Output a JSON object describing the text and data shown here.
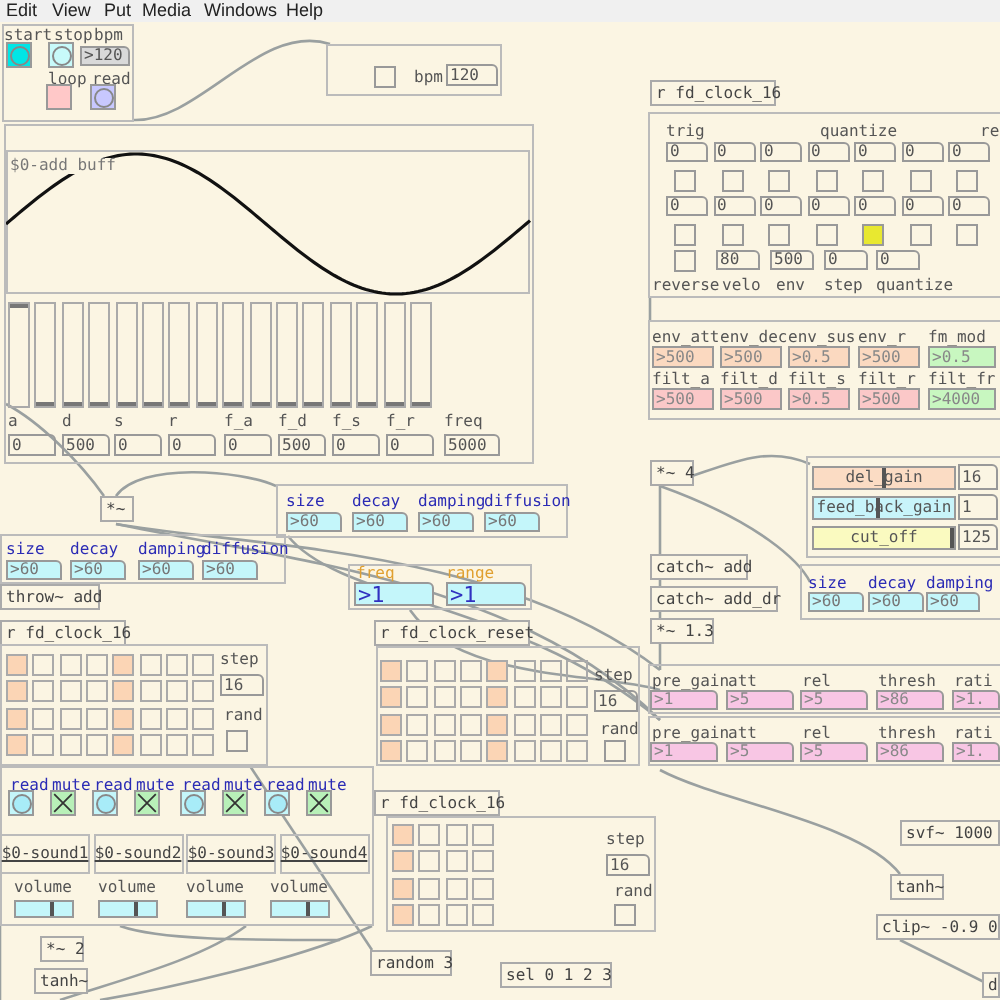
{
  "menu": [
    "Edit",
    "View",
    "Put",
    "Media",
    "Windows",
    "Help"
  ],
  "transport": {
    "labels": [
      "start",
      "stop",
      "bpm"
    ],
    "bpm": ">120",
    "loop_label": "loop",
    "read_label": "read"
  },
  "bpm_box": {
    "on": false,
    "label": "bpm",
    "value": "120"
  },
  "array": {
    "name": "$0-add buff"
  },
  "sliders": [
    {
      "level": 1
    },
    {
      "level": 0
    },
    {
      "level": 0
    },
    {
      "level": 0
    },
    {
      "level": 0
    },
    {
      "level": 0
    },
    {
      "level": 0
    },
    {
      "level": 0
    },
    {
      "level": 0
    },
    {
      "level": 0
    },
    {
      "level": 0
    },
    {
      "level": 0
    },
    {
      "level": 0
    },
    {
      "level": 0
    },
    {
      "level": 0
    },
    {
      "level": 0
    }
  ],
  "envelope": [
    {
      "label": "a",
      "value": "0"
    },
    {
      "label": "d",
      "value": "500"
    },
    {
      "label": "s",
      "value": "0"
    },
    {
      "label": "r",
      "value": "0"
    },
    {
      "label": "f_a",
      "value": "0"
    },
    {
      "label": "f_d",
      "value": "500"
    },
    {
      "label": "f_s",
      "value": "0"
    },
    {
      "label": "f_r",
      "value": "0"
    },
    {
      "label": "freq",
      "value": "5000"
    }
  ],
  "objects": [
    "*~",
    "throw~ add",
    "r fd_clock_16",
    "r fd_clock_reset",
    "r fd_clock_16",
    "*~ 2",
    "tanh~",
    "random 3",
    "sel 0 1 2 3",
    "r fd_clock_16",
    "*~ 4",
    "catch~ add",
    "catch~ add_dr",
    "*~ 1.3",
    "svf~ 1000",
    "tanh~",
    "clip~ -0.9 0",
    "d"
  ],
  "reverbs": [
    {
      "params": [
        {
          "label": "size",
          "value": ">60"
        },
        {
          "label": "decay",
          "value": ">60"
        },
        {
          "label": "damping",
          "value": ">60"
        },
        {
          "label": "diffusion",
          "value": ">60"
        }
      ]
    },
    {
      "params": [
        {
          "label": "size",
          "value": ">60"
        },
        {
          "label": "decay",
          "value": ">60"
        },
        {
          "label": "damping",
          "value": ">60"
        },
        {
          "label": "diffusion",
          "value": ">60"
        }
      ]
    },
    {
      "params": [
        {
          "label": "size",
          "value": ">60"
        },
        {
          "label": "decay",
          "value": ">60"
        },
        {
          "label": "damping",
          "value": ">60"
        }
      ]
    }
  ],
  "freq_range": [
    {
      "label": "freq",
      "value": ">1"
    },
    {
      "label": "range",
      "value": ">1"
    }
  ],
  "sequencers": [
    {
      "grid": [
        [
          true,
          false,
          false,
          false,
          true,
          false,
          false,
          false
        ],
        [
          true,
          false,
          false,
          false,
          true,
          false,
          false,
          false
        ],
        [
          true,
          false,
          false,
          false,
          true,
          false,
          false,
          false
        ],
        [
          true,
          false,
          false,
          false,
          true,
          false,
          false,
          false
        ]
      ],
      "step_label": "step",
      "step": "16",
      "rand_label": "rand",
      "rand_on": false
    },
    {
      "grid": [
        [
          true,
          false,
          false,
          false,
          true,
          false,
          false,
          false
        ],
        [
          true,
          false,
          false,
          false,
          true,
          false,
          false,
          false
        ],
        [
          true,
          false,
          false,
          false,
          true,
          false,
          false,
          false
        ],
        [
          true,
          false,
          false,
          false,
          true,
          false,
          false,
          false
        ]
      ],
      "step_label": "step",
      "step": "16",
      "rand_label": "rand",
      "rand_on": false
    },
    {
      "grid": [
        [
          true,
          false,
          false,
          false
        ],
        [
          true,
          false,
          false,
          false
        ],
        [
          true,
          false,
          false,
          false
        ],
        [
          true,
          false,
          false,
          false
        ]
      ],
      "step_label": "step",
      "step": "16",
      "rand_label": "rand",
      "rand_on": false
    }
  ],
  "samplers": [
    {
      "read": "read",
      "mute": "mute",
      "muted": true,
      "array": "$0-sound1",
      "volume_label": "volume",
      "level": 0.65
    },
    {
      "read": "read",
      "mute": "mute",
      "muted": true,
      "array": "$0-sound2",
      "volume_label": "volume",
      "level": 0.65
    },
    {
      "read": "read",
      "mute": "mute",
      "muted": true,
      "array": "$0-sound3",
      "volume_label": "volume",
      "level": 0.65
    },
    {
      "read": "read",
      "mute": "mute",
      "muted": true,
      "array": "$0-sound4",
      "volume_label": "volume",
      "level": 0.65
    }
  ],
  "trig_panel": {
    "labels": [
      "trig",
      "quantize",
      "re"
    ],
    "row1": [
      "0",
      "0",
      "0",
      "0",
      "0",
      "0",
      "0"
    ],
    "toggles1": [
      false,
      false,
      false,
      false,
      false,
      false,
      false
    ],
    "row2": [
      "0",
      "0",
      "0",
      "0",
      "0",
      "0",
      "0"
    ],
    "toggles2": [
      false,
      false,
      false,
      false,
      true,
      false,
      false
    ],
    "reverse_on": false,
    "values": [
      "80",
      "500",
      "0",
      "0"
    ],
    "bottom_labels": [
      "reverse",
      "velo",
      "env",
      "step",
      "quantize"
    ]
  },
  "synth": [
    [
      {
        "label": "env_att",
        "value": ">500",
        "color": "#fbd9c0"
      },
      {
        "label": "env_dec",
        "value": ">500",
        "color": "#fbd9c0"
      },
      {
        "label": "env_sus",
        "value": ">0.5",
        "color": "#fbd9c0"
      },
      {
        "label": "env_r",
        "value": ">500",
        "color": "#fbd9c0"
      },
      {
        "label": "fm_mod",
        "value": ">0.5",
        "color": "#c8f7c0"
      }
    ],
    [
      {
        "label": "filt_a",
        "value": ">500",
        "color": "#fbc8c8"
      },
      {
        "label": "filt_d",
        "value": ">500",
        "color": "#fbc8c8"
      },
      {
        "label": "filt_s",
        "value": ">0.5",
        "color": "#fbc8c8"
      },
      {
        "label": "filt_r",
        "value": ">500",
        "color": "#fbc8c8"
      },
      {
        "label": "filt_fr",
        "value": ">4000",
        "color": "#c8f7c0"
      }
    ]
  ],
  "mixer": [
    {
      "label": "del_gain",
      "value": "16",
      "color": "#fbdcc4",
      "level": 0.5
    },
    {
      "label": "feed_back_gain",
      "value": "1",
      "color": "#c8f4fa",
      "level": 0.45
    },
    {
      "label": "cut_off",
      "value": "125",
      "color": "#fafac0",
      "level": 1
    }
  ],
  "compressor": [
    [
      {
        "label": "pre_gain",
        "value": ">1"
      },
      {
        "label": "att",
        "value": ">5"
      },
      {
        "label": "rel",
        "value": ">5"
      },
      {
        "label": "thresh",
        "value": ">86"
      },
      {
        "label": "rati",
        "value": ">1."
      }
    ],
    [
      {
        "label": "pre_gain",
        "value": ">1"
      },
      {
        "label": "att",
        "value": ">5"
      },
      {
        "label": "rel",
        "value": ">5"
      },
      {
        "label": "thresh",
        "value": ">86"
      },
      {
        "label": "rati",
        "value": ">1."
      }
    ]
  ]
}
